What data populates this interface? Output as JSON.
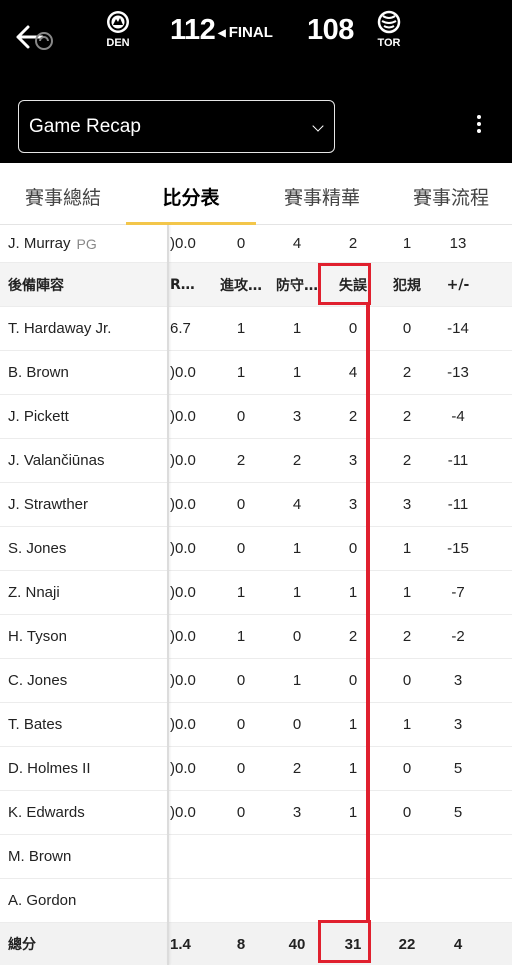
{
  "game": {
    "home": {
      "abbr": "DEN",
      "score": "112",
      "icon": "nuggets-logo-icon"
    },
    "away": {
      "abbr": "TOR",
      "score": "108",
      "icon": "raptors-logo-icon"
    },
    "status": "FINAL"
  },
  "header": {
    "select_value": "Game Recap"
  },
  "tabs": [
    {
      "label": "賽事總結",
      "active": false
    },
    {
      "label": "比分表",
      "active": true
    },
    {
      "label": "賽事精華",
      "active": false
    },
    {
      "label": "賽事流程",
      "active": false
    }
  ],
  "top_row": {
    "name": "J. Murray",
    "pos": "PG",
    "cells": [
      ")0.0",
      "0",
      "4",
      "2",
      "1",
      "13"
    ]
  },
  "bench": {
    "title": "後備陣容",
    "columns": [
      "R…",
      "進攻…",
      "防守…",
      "失誤",
      "犯規",
      "+/-"
    ],
    "rows": [
      {
        "name": "T. Hardaway Jr.",
        "cells": [
          "6.7",
          "1",
          "1",
          "0",
          "0",
          "-14"
        ]
      },
      {
        "name": "B. Brown",
        "cells": [
          ")0.0",
          "1",
          "1",
          "4",
          "2",
          "-13"
        ]
      },
      {
        "name": "J. Pickett",
        "cells": [
          ")0.0",
          "0",
          "3",
          "2",
          "2",
          "-4"
        ]
      },
      {
        "name": "J. Valančiūnas",
        "cells": [
          ")0.0",
          "2",
          "2",
          "3",
          "2",
          "-11"
        ]
      },
      {
        "name": "J. Strawther",
        "cells": [
          ")0.0",
          "0",
          "4",
          "3",
          "3",
          "-11"
        ]
      },
      {
        "name": "S. Jones",
        "cells": [
          ")0.0",
          "0",
          "1",
          "0",
          "1",
          "-15"
        ]
      },
      {
        "name": "Z. Nnaji",
        "cells": [
          ")0.0",
          "1",
          "1",
          "1",
          "1",
          "-7"
        ]
      },
      {
        "name": "H. Tyson",
        "cells": [
          ")0.0",
          "1",
          "0",
          "2",
          "2",
          "-2"
        ]
      },
      {
        "name": "C. Jones",
        "cells": [
          ")0.0",
          "0",
          "1",
          "0",
          "0",
          "3"
        ]
      },
      {
        "name": "T. Bates",
        "cells": [
          ")0.0",
          "0",
          "0",
          "1",
          "1",
          "3"
        ]
      },
      {
        "name": "D. Holmes II",
        "cells": [
          ")0.0",
          "0",
          "2",
          "1",
          "0",
          "5"
        ]
      },
      {
        "name": "K. Edwards",
        "cells": [
          ")0.0",
          "0",
          "3",
          "1",
          "0",
          "5"
        ]
      },
      {
        "name": "M. Brown",
        "cells": [
          "",
          "",
          "",
          "",
          "",
          ""
        ]
      },
      {
        "name": "A. Gordon",
        "cells": [
          "",
          "",
          "",
          "",
          "",
          ""
        ]
      }
    ]
  },
  "total": {
    "label": "總分",
    "cells": [
      "1.4",
      "8",
      "40",
      "31",
      "22",
      "4"
    ]
  },
  "colors": {
    "highlight": "#e0202e",
    "tab_accent": "#f3c64a",
    "topbar": "#000000"
  }
}
